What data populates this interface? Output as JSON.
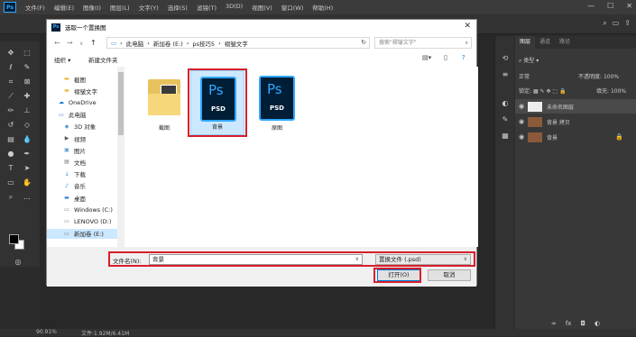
{
  "app": {
    "logo_text": "Ps",
    "menu": [
      "文件(F)",
      "编辑(E)",
      "图像(I)",
      "图层(L)",
      "文字(Y)",
      "选择(S)",
      "滤镜(T)",
      "3D(D)",
      "视图(V)",
      "窗口(W)",
      "帮助(H)"
    ]
  },
  "status": {
    "zoom": "90.91%",
    "doc": "文件:1.92M/6.41M"
  },
  "layers_panel": {
    "tabs": [
      "图层",
      "通道",
      "路径"
    ],
    "filter_label": "类型",
    "blend_mode": "正常",
    "opacity_label": "不透明度:",
    "opacity_value": "100%",
    "lock_label": "锁定:",
    "fill_label": "填充:",
    "fill_value": "100%",
    "layers": [
      {
        "name": "未命名图层",
        "selected": true
      },
      {
        "name": "背景 拷贝",
        "selected": false
      },
      {
        "name": "背景",
        "selected": false,
        "locked": true
      }
    ]
  },
  "dialog": {
    "title": "选取一个置换图",
    "path": [
      "此电脑",
      "新加卷 (E:)",
      "ps技巧5",
      "褶皱文字"
    ],
    "search_placeholder": "搜索\"褶皱文字\"",
    "organize": "组织 ▾",
    "new_folder": "新建文件夹",
    "nav_items": [
      {
        "label": "截图",
        "icon": "folder-icon",
        "indent": 1
      },
      {
        "label": "褶皱文字",
        "icon": "folder-icon",
        "indent": 1
      },
      {
        "label": "OneDrive",
        "icon": "cloud-icon",
        "indent": 0
      },
      {
        "label": "此电脑",
        "icon": "computer-icon",
        "indent": 0
      },
      {
        "label": "3D 对象",
        "icon": "cube-icon",
        "indent": 1
      },
      {
        "label": "视频",
        "icon": "video-icon",
        "indent": 1
      },
      {
        "label": "图片",
        "icon": "picture-icon",
        "indent": 1
      },
      {
        "label": "文档",
        "icon": "document-icon",
        "indent": 1
      },
      {
        "label": "下载",
        "icon": "download-icon",
        "indent": 1
      },
      {
        "label": "音乐",
        "icon": "music-icon",
        "indent": 1
      },
      {
        "label": "桌面",
        "icon": "desktop-icon",
        "indent": 1
      },
      {
        "label": "Windows (C:)",
        "icon": "drive-icon",
        "indent": 1
      },
      {
        "label": "LENOVO (D:)",
        "icon": "drive-icon",
        "indent": 1
      },
      {
        "label": "新加卷 (E:)",
        "icon": "drive-icon",
        "indent": 1,
        "selected": true
      }
    ],
    "files": [
      {
        "name": "截图",
        "type": "folder"
      },
      {
        "name": "背景",
        "type": "psd",
        "selected": true
      },
      {
        "name": "原图",
        "type": "psd"
      }
    ],
    "psd_ps_text": "Ps",
    "psd_psd_text": "PSD",
    "filename_label": "文件名(N):",
    "filename_value": "背景",
    "filetype_value": "置换文件 (.psd)",
    "open_button": "打开(O)",
    "cancel_button": "取消"
  },
  "colors": {
    "accent": "#31a8ff",
    "highlight": "#d61f2b",
    "selection": "#cce8ff"
  }
}
